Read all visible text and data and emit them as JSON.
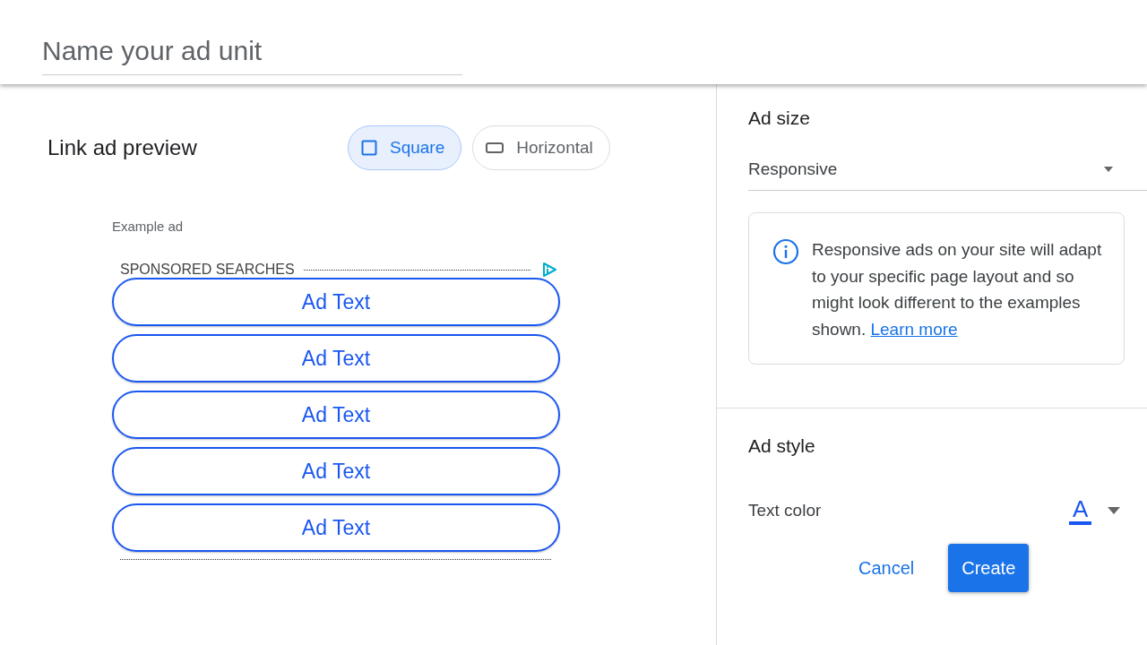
{
  "header": {
    "placeholder": "Name your ad unit"
  },
  "preview": {
    "title": "Link ad preview",
    "shapes": [
      {
        "label": "Square",
        "kind": "square",
        "selected": true
      },
      {
        "label": "Horizontal",
        "kind": "horizontal",
        "selected": false
      }
    ],
    "example_label": "Example ad",
    "sponsored_label": "SPONSORED SEARCHES",
    "ad_links": [
      "Ad Text",
      "Ad Text",
      "Ad Text",
      "Ad Text",
      "Ad Text"
    ]
  },
  "ad_size": {
    "title": "Ad size",
    "value": "Responsive",
    "info": "Responsive ads on your site will adapt to your specific page layout and so might look different to the examples shown.",
    "info_link": "Learn more"
  },
  "ad_style": {
    "title": "Ad style",
    "text_color_label": "Text color",
    "text_color_swatch": "A"
  },
  "buttons": [
    {
      "label": "Cancel",
      "kind": "text"
    },
    {
      "label": "Create",
      "kind": "primary"
    }
  ]
}
